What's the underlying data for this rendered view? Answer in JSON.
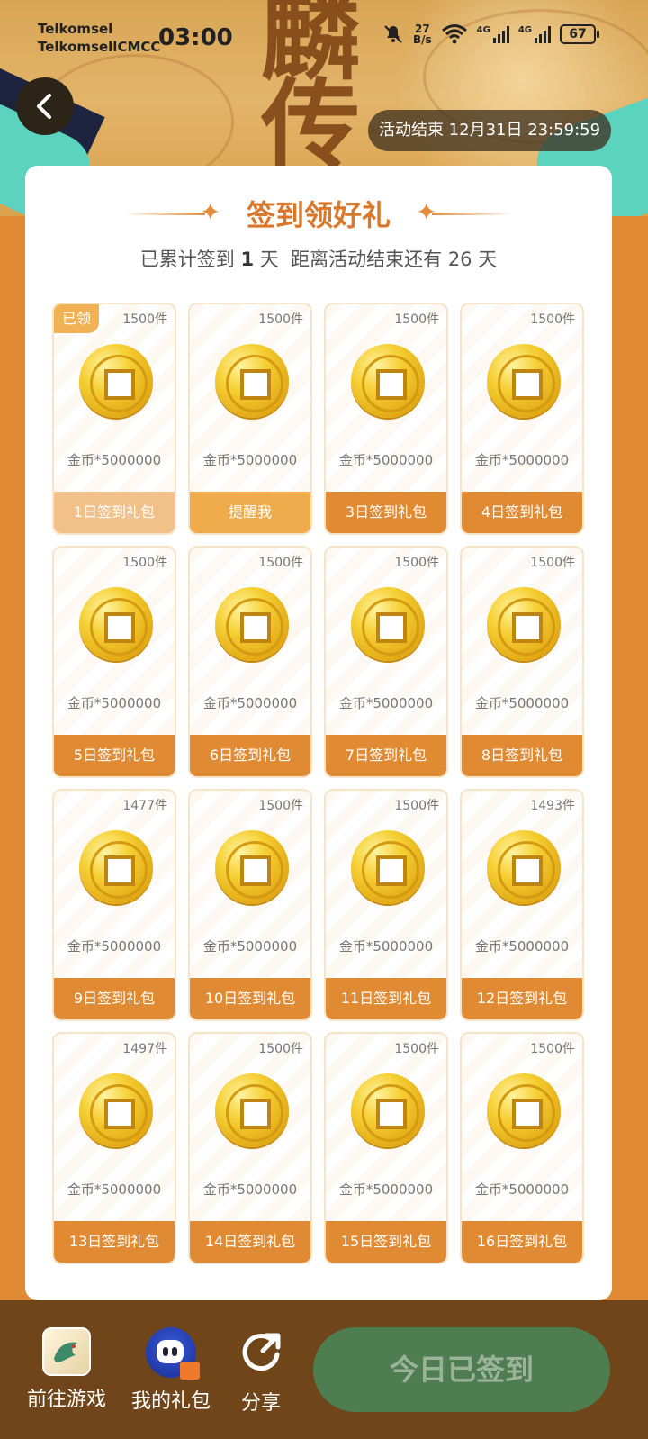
{
  "status_bar": {
    "carrier_1": "Telkomsel",
    "carrier_2": "TelkomsellCMCC",
    "time": "03:00",
    "net_speed_value": "27",
    "net_speed_unit": "B/s",
    "sig1_label": "4G",
    "sig2_label": "4G",
    "battery": "67"
  },
  "banner": {
    "calligraphy": "麟\n传",
    "end_label": "活动结束 12月31日 23:59:59"
  },
  "card": {
    "title": "签到领好礼",
    "subtitle_prefix": "已累计签到",
    "days_signed": "1",
    "subtitle_mid": "天  距离活动结束还有",
    "days_left": "26",
    "subtitle_suffix": "天"
  },
  "claimed_badge": "已领",
  "tiles": [
    {
      "count": "1500件",
      "reward": "金币*5000000",
      "button": "1日签到礼包",
      "state": "claimed"
    },
    {
      "count": "1500件",
      "reward": "金币*5000000",
      "button": "提醒我",
      "state": "remind"
    },
    {
      "count": "1500件",
      "reward": "金币*5000000",
      "button": "3日签到礼包",
      "state": "normal"
    },
    {
      "count": "1500件",
      "reward": "金币*5000000",
      "button": "4日签到礼包",
      "state": "normal"
    },
    {
      "count": "1500件",
      "reward": "金币*5000000",
      "button": "5日签到礼包",
      "state": "normal"
    },
    {
      "count": "1500件",
      "reward": "金币*5000000",
      "button": "6日签到礼包",
      "state": "normal"
    },
    {
      "count": "1500件",
      "reward": "金币*5000000",
      "button": "7日签到礼包",
      "state": "normal"
    },
    {
      "count": "1500件",
      "reward": "金币*5000000",
      "button": "8日签到礼包",
      "state": "normal"
    },
    {
      "count": "1477件",
      "reward": "金币*5000000",
      "button": "9日签到礼包",
      "state": "normal"
    },
    {
      "count": "1500件",
      "reward": "金币*5000000",
      "button": "10日签到礼包",
      "state": "normal"
    },
    {
      "count": "1500件",
      "reward": "金币*5000000",
      "button": "11日签到礼包",
      "state": "normal"
    },
    {
      "count": "1493件",
      "reward": "金币*5000000",
      "button": "12日签到礼包",
      "state": "normal"
    },
    {
      "count": "1497件",
      "reward": "金币*5000000",
      "button": "13日签到礼包",
      "state": "normal"
    },
    {
      "count": "1500件",
      "reward": "金币*5000000",
      "button": "14日签到礼包",
      "state": "normal"
    },
    {
      "count": "1500件",
      "reward": "金币*5000000",
      "button": "15日签到礼包",
      "state": "normal"
    },
    {
      "count": "1500件",
      "reward": "金币*5000000",
      "button": "16日签到礼包",
      "state": "normal"
    }
  ],
  "bottom_bar": {
    "game_label": "前往游戏",
    "gift_label": "我的礼包",
    "share_label": "分享",
    "signed_button": "今日已签到"
  },
  "colors": {
    "accent": "#e08a33",
    "bottom_bar": "#6f4519",
    "signed_button": "#4e7d4f"
  }
}
